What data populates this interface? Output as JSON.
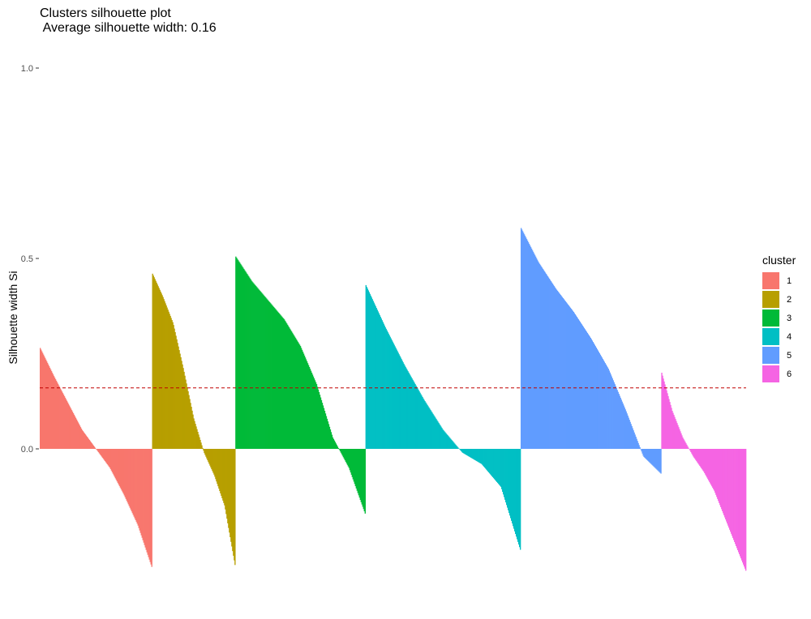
{
  "chart_data": {
    "type": "bar",
    "title": "Clusters silhouette plot",
    "subtitle": " Average silhouette width: 0.16",
    "xlabel": "",
    "ylabel": "Silhouette width Si",
    "ylim": [
      -0.35,
      1.0
    ],
    "yticks": [
      {
        "value": 0.0,
        "label": "0.0"
      },
      {
        "value": 0.5,
        "label": "0.5"
      },
      {
        "value": 1.0,
        "label": "1.0"
      }
    ],
    "grid": false,
    "average_line": {
      "value": 0.16,
      "color": "#c00000",
      "style": "dashed"
    },
    "legend": {
      "title": "cluster",
      "position": "right"
    },
    "clusters": [
      {
        "name": "1",
        "color": "#F8766D",
        "n": 139,
        "profile": [
          0.265,
          0.19,
          0.12,
          0.05,
          0.0,
          -0.05,
          -0.12,
          -0.2,
          -0.31
        ]
      },
      {
        "name": "2",
        "color": "#B79F00",
        "n": 103,
        "profile": [
          0.46,
          0.4,
          0.33,
          0.21,
          0.08,
          -0.01,
          -0.07,
          -0.15,
          -0.305
        ]
      },
      {
        "name": "3",
        "color": "#00BA38",
        "n": 161,
        "profile": [
          0.505,
          0.44,
          0.39,
          0.34,
          0.27,
          0.17,
          0.03,
          -0.05,
          -0.17
        ]
      },
      {
        "name": "4",
        "color": "#00BFC4",
        "n": 192,
        "profile": [
          0.43,
          0.32,
          0.22,
          0.13,
          0.05,
          -0.01,
          -0.04,
          -0.1,
          -0.265
        ]
      },
      {
        "name": "5",
        "color": "#619CFF",
        "n": 174,
        "profile": [
          0.58,
          0.49,
          0.42,
          0.36,
          0.29,
          0.21,
          0.1,
          -0.02,
          -0.065
        ]
      },
      {
        "name": "6",
        "color": "#F564E3",
        "n": 105,
        "profile": [
          0.2,
          0.1,
          0.03,
          -0.02,
          -0.06,
          -0.11,
          -0.18,
          -0.25,
          -0.32
        ]
      }
    ]
  }
}
